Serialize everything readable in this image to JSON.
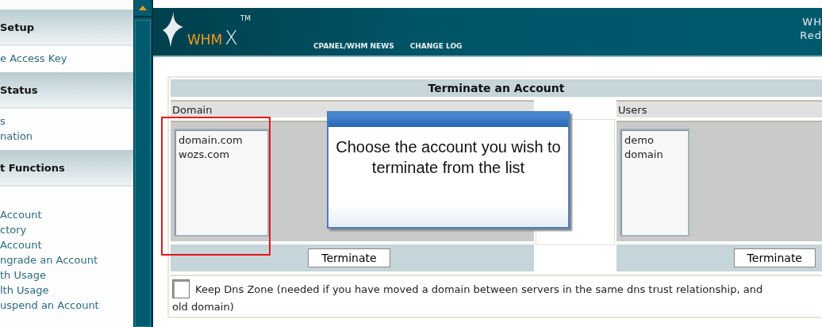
{
  "sidebar": {
    "sections": [
      {
        "title": "Setup",
        "items": [
          "e Access Key"
        ]
      },
      {
        "title": "Status",
        "items": [
          "s",
          "nation"
        ]
      },
      {
        "title": "t Functions",
        "items": [
          "Account",
          "ctory",
          "Account",
          "ngrade an Account",
          "th Usage",
          "lth Usage",
          "uspend an Account"
        ]
      }
    ]
  },
  "header": {
    "logo": {
      "brand": "WHM",
      "mark": "X",
      "tm": "TM"
    },
    "nav": [
      "CPANEL/WHM NEWS",
      "CHANGE LOG"
    ],
    "right_lines": [
      "WH",
      "Red"
    ]
  },
  "panel": {
    "title": "Terminate an Account",
    "domain": {
      "heading": "Domain",
      "options": [
        "domain.com",
        "wozs.com"
      ],
      "button": "Terminate"
    },
    "users": {
      "heading": "Users",
      "options": [
        "demo",
        "domain"
      ],
      "button": "Terminate"
    },
    "keep_dns": {
      "checked": false,
      "label": "Keep Dns Zone (needed if you have moved a domain between servers in the same dns trust relationship, and",
      "label_rest": "old domain)"
    }
  },
  "callout": {
    "text": "Choose the account you wish to terminate from the list"
  }
}
